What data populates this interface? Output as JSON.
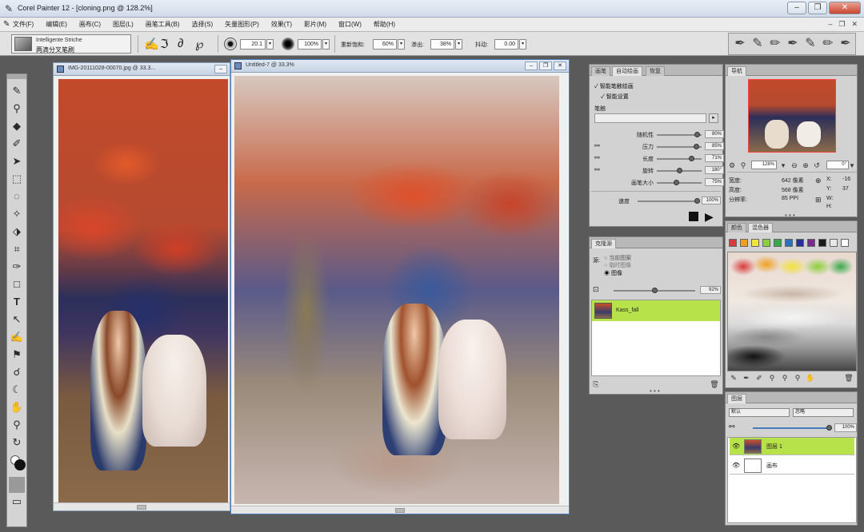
{
  "window": {
    "title": "Corel Painter 12 - [cloning.png @ 128.2%]",
    "controls": [
      "–",
      "❐",
      "✕"
    ]
  },
  "menu": {
    "items": [
      "文件(F)",
      "编辑(E)",
      "画布(C)",
      "图层(L)",
      "画笔工具(B)",
      "选择(S)",
      "矢量图形(P)",
      "效果(T)",
      "影片(M)",
      "窗口(W)",
      "帮助(H)"
    ]
  },
  "property_bar": {
    "brush_category": "Intelligente Striche",
    "brush_variant": "两滴分叉笔刷",
    "size_value": "20.1",
    "opacity_value": "100%",
    "resat_label": "重新饱和:",
    "resat_value": "60%",
    "bleed_label": "渗出:",
    "bleed_value": "38%",
    "jitter_label": "抖动:",
    "jitter_value": "0.00"
  },
  "documents": {
    "source": {
      "title": "IMG-20111028-00070.jpg @ 33.3..."
    },
    "target": {
      "title": "Untitled-7 @ 33.3%"
    }
  },
  "auto_painting": {
    "tabs": [
      "画笔",
      "自动绘画",
      "恢复"
    ],
    "checkbox1": "智能笔触绘画",
    "checkbox2": "智能设置",
    "stroke_label": "笔触",
    "stroke_select": "",
    "sliders": [
      {
        "label": "随机性",
        "value": "80%",
        "pos": 0.85
      },
      {
        "label": "压力",
        "value": "85%",
        "pos": 0.83
      },
      {
        "label": "长度",
        "value": "71%",
        "pos": 0.72
      },
      {
        "label": "旋转",
        "value": "180°",
        "pos": 0.5
      },
      {
        "label": "画笔大小",
        "value": "75%",
        "pos": 0.45
      }
    ],
    "speed_label": "速度",
    "speed_value": "100%"
  },
  "clone_source": {
    "tabs": [
      "克隆源"
    ],
    "options": [
      "当前图案",
      "临时图像",
      "图像"
    ],
    "opacity_value": "92%",
    "source_name": "Kass_fall"
  },
  "navigator": {
    "tab": "导航",
    "zoom": "128%",
    "rotation": "0°",
    "width_label": "宽度:",
    "width_value": "642 像素",
    "height_label": "高度:",
    "height_value": "568 像素",
    "resolution_label": "分辨率:",
    "resolution_value": "85 PPI",
    "x_label": "X:",
    "x_value": "-16",
    "y_label": "Y:",
    "y_value": "37",
    "w_label": "W:",
    "h_label": "H:"
  },
  "mixer": {
    "tabs": [
      "颜色",
      "混色器"
    ],
    "swatches": [
      "#d83b3b",
      "#f0a020",
      "#f2e23c",
      "#8ccf3a",
      "#3aa84a",
      "#2c6fbf",
      "#2a2e9a",
      "#7a2a8a",
      "#1a1a1a",
      "#e8e8e8",
      "#ffffff"
    ]
  },
  "layers": {
    "tab": "图层",
    "composite_method": "默认",
    "composite_depth": "忽略",
    "opacity_value": "100%",
    "rows": [
      {
        "name": "图层 1",
        "active": true
      },
      {
        "name": "画布",
        "active": false
      }
    ]
  }
}
